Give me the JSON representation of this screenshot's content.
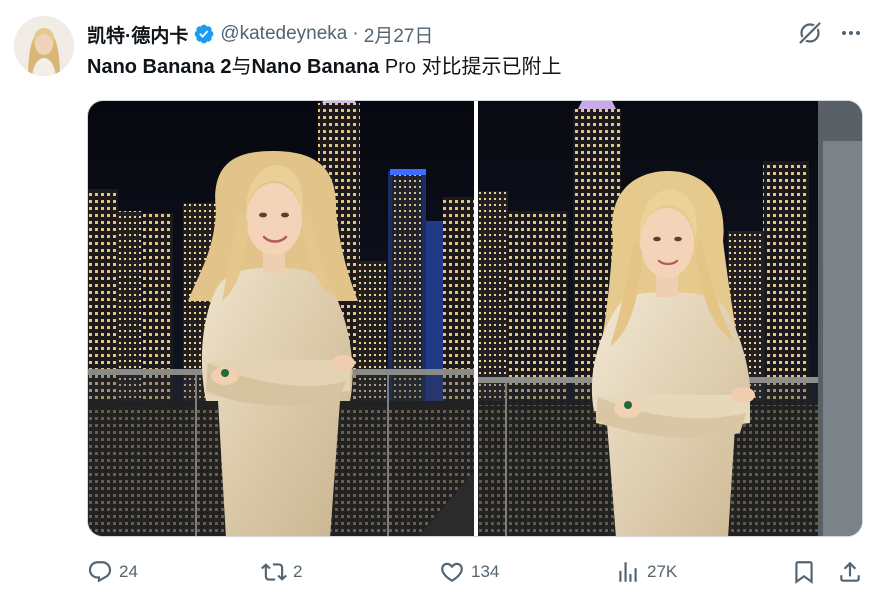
{
  "author": {
    "display_name": "凯特·德内卡",
    "handle": "@katedeyneka",
    "separator": "·",
    "date": "2月27日",
    "verified": true
  },
  "tweet": {
    "text_part1": "Nano Banana 2",
    "text_part2": "与",
    "text_part3": "Nano Banana",
    "text_part4": " Pro 对比提示已附上"
  },
  "media": {
    "count": 2,
    "scene": "woman in cream satin dress on rooftop balcony at night with city skyline"
  },
  "actions": {
    "replies": "24",
    "reposts": "2",
    "likes": "134",
    "views": "27K"
  },
  "icons": {
    "reply": "reply-icon",
    "repost": "repost-icon",
    "like": "heart-icon",
    "views": "views-icon",
    "bookmark": "bookmark-icon",
    "share": "share-icon",
    "grok": "grok-icon",
    "more": "more-icon",
    "verified": "verified-badge-icon"
  },
  "colors": {
    "text_primary": "#0f1419",
    "text_secondary": "#536471",
    "verified": "#1d9bf0",
    "night_sky": "#0a0c16"
  }
}
